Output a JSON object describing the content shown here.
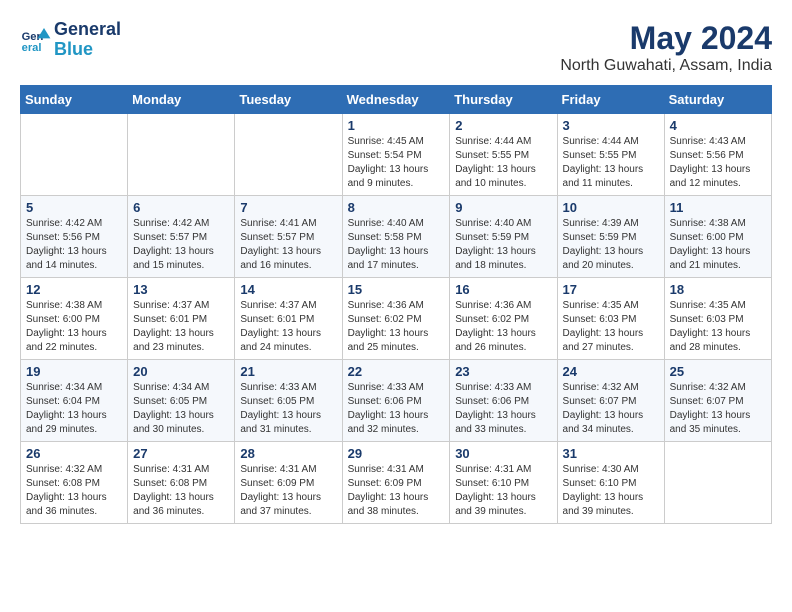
{
  "logo": {
    "line1": "General",
    "line2": "Blue"
  },
  "title": "May 2024",
  "subtitle": "North Guwahati, Assam, India",
  "weekdays": [
    "Sunday",
    "Monday",
    "Tuesday",
    "Wednesday",
    "Thursday",
    "Friday",
    "Saturday"
  ],
  "weeks": [
    [
      {
        "day": "",
        "sunrise": "",
        "sunset": "",
        "daylight": ""
      },
      {
        "day": "",
        "sunrise": "",
        "sunset": "",
        "daylight": ""
      },
      {
        "day": "",
        "sunrise": "",
        "sunset": "",
        "daylight": ""
      },
      {
        "day": "1",
        "sunrise": "Sunrise: 4:45 AM",
        "sunset": "Sunset: 5:54 PM",
        "daylight": "Daylight: 13 hours and 9 minutes."
      },
      {
        "day": "2",
        "sunrise": "Sunrise: 4:44 AM",
        "sunset": "Sunset: 5:55 PM",
        "daylight": "Daylight: 13 hours and 10 minutes."
      },
      {
        "day": "3",
        "sunrise": "Sunrise: 4:44 AM",
        "sunset": "Sunset: 5:55 PM",
        "daylight": "Daylight: 13 hours and 11 minutes."
      },
      {
        "day": "4",
        "sunrise": "Sunrise: 4:43 AM",
        "sunset": "Sunset: 5:56 PM",
        "daylight": "Daylight: 13 hours and 12 minutes."
      }
    ],
    [
      {
        "day": "5",
        "sunrise": "Sunrise: 4:42 AM",
        "sunset": "Sunset: 5:56 PM",
        "daylight": "Daylight: 13 hours and 14 minutes."
      },
      {
        "day": "6",
        "sunrise": "Sunrise: 4:42 AM",
        "sunset": "Sunset: 5:57 PM",
        "daylight": "Daylight: 13 hours and 15 minutes."
      },
      {
        "day": "7",
        "sunrise": "Sunrise: 4:41 AM",
        "sunset": "Sunset: 5:57 PM",
        "daylight": "Daylight: 13 hours and 16 minutes."
      },
      {
        "day": "8",
        "sunrise": "Sunrise: 4:40 AM",
        "sunset": "Sunset: 5:58 PM",
        "daylight": "Daylight: 13 hours and 17 minutes."
      },
      {
        "day": "9",
        "sunrise": "Sunrise: 4:40 AM",
        "sunset": "Sunset: 5:59 PM",
        "daylight": "Daylight: 13 hours and 18 minutes."
      },
      {
        "day": "10",
        "sunrise": "Sunrise: 4:39 AM",
        "sunset": "Sunset: 5:59 PM",
        "daylight": "Daylight: 13 hours and 20 minutes."
      },
      {
        "day": "11",
        "sunrise": "Sunrise: 4:38 AM",
        "sunset": "Sunset: 6:00 PM",
        "daylight": "Daylight: 13 hours and 21 minutes."
      }
    ],
    [
      {
        "day": "12",
        "sunrise": "Sunrise: 4:38 AM",
        "sunset": "Sunset: 6:00 PM",
        "daylight": "Daylight: 13 hours and 22 minutes."
      },
      {
        "day": "13",
        "sunrise": "Sunrise: 4:37 AM",
        "sunset": "Sunset: 6:01 PM",
        "daylight": "Daylight: 13 hours and 23 minutes."
      },
      {
        "day": "14",
        "sunrise": "Sunrise: 4:37 AM",
        "sunset": "Sunset: 6:01 PM",
        "daylight": "Daylight: 13 hours and 24 minutes."
      },
      {
        "day": "15",
        "sunrise": "Sunrise: 4:36 AM",
        "sunset": "Sunset: 6:02 PM",
        "daylight": "Daylight: 13 hours and 25 minutes."
      },
      {
        "day": "16",
        "sunrise": "Sunrise: 4:36 AM",
        "sunset": "Sunset: 6:02 PM",
        "daylight": "Daylight: 13 hours and 26 minutes."
      },
      {
        "day": "17",
        "sunrise": "Sunrise: 4:35 AM",
        "sunset": "Sunset: 6:03 PM",
        "daylight": "Daylight: 13 hours and 27 minutes."
      },
      {
        "day": "18",
        "sunrise": "Sunrise: 4:35 AM",
        "sunset": "Sunset: 6:03 PM",
        "daylight": "Daylight: 13 hours and 28 minutes."
      }
    ],
    [
      {
        "day": "19",
        "sunrise": "Sunrise: 4:34 AM",
        "sunset": "Sunset: 6:04 PM",
        "daylight": "Daylight: 13 hours and 29 minutes."
      },
      {
        "day": "20",
        "sunrise": "Sunrise: 4:34 AM",
        "sunset": "Sunset: 6:05 PM",
        "daylight": "Daylight: 13 hours and 30 minutes."
      },
      {
        "day": "21",
        "sunrise": "Sunrise: 4:33 AM",
        "sunset": "Sunset: 6:05 PM",
        "daylight": "Daylight: 13 hours and 31 minutes."
      },
      {
        "day": "22",
        "sunrise": "Sunrise: 4:33 AM",
        "sunset": "Sunset: 6:06 PM",
        "daylight": "Daylight: 13 hours and 32 minutes."
      },
      {
        "day": "23",
        "sunrise": "Sunrise: 4:33 AM",
        "sunset": "Sunset: 6:06 PM",
        "daylight": "Daylight: 13 hours and 33 minutes."
      },
      {
        "day": "24",
        "sunrise": "Sunrise: 4:32 AM",
        "sunset": "Sunset: 6:07 PM",
        "daylight": "Daylight: 13 hours and 34 minutes."
      },
      {
        "day": "25",
        "sunrise": "Sunrise: 4:32 AM",
        "sunset": "Sunset: 6:07 PM",
        "daylight": "Daylight: 13 hours and 35 minutes."
      }
    ],
    [
      {
        "day": "26",
        "sunrise": "Sunrise: 4:32 AM",
        "sunset": "Sunset: 6:08 PM",
        "daylight": "Daylight: 13 hours and 36 minutes."
      },
      {
        "day": "27",
        "sunrise": "Sunrise: 4:31 AM",
        "sunset": "Sunset: 6:08 PM",
        "daylight": "Daylight: 13 hours and 36 minutes."
      },
      {
        "day": "28",
        "sunrise": "Sunrise: 4:31 AM",
        "sunset": "Sunset: 6:09 PM",
        "daylight": "Daylight: 13 hours and 37 minutes."
      },
      {
        "day": "29",
        "sunrise": "Sunrise: 4:31 AM",
        "sunset": "Sunset: 6:09 PM",
        "daylight": "Daylight: 13 hours and 38 minutes."
      },
      {
        "day": "30",
        "sunrise": "Sunrise: 4:31 AM",
        "sunset": "Sunset: 6:10 PM",
        "daylight": "Daylight: 13 hours and 39 minutes."
      },
      {
        "day": "31",
        "sunrise": "Sunrise: 4:30 AM",
        "sunset": "Sunset: 6:10 PM",
        "daylight": "Daylight: 13 hours and 39 minutes."
      },
      {
        "day": "",
        "sunrise": "",
        "sunset": "",
        "daylight": ""
      }
    ]
  ]
}
